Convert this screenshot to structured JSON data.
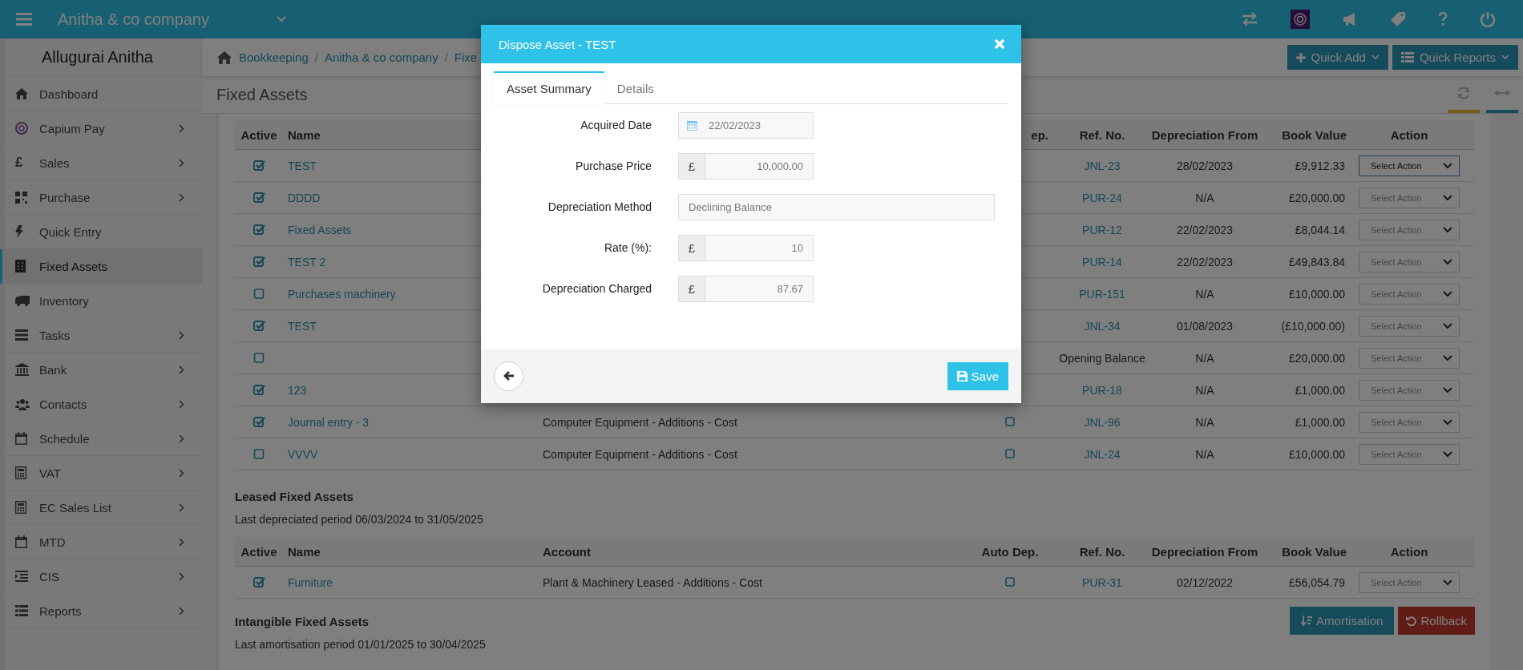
{
  "top_bar": {
    "company": "Anitha & co company"
  },
  "sidebar": {
    "user": "Allugurai Anitha",
    "items": [
      {
        "label": "Dashboard",
        "selected": false,
        "expandable": false
      },
      {
        "label": "Capium Pay",
        "selected": false,
        "expandable": true
      },
      {
        "label": "Sales",
        "selected": false,
        "expandable": true,
        "glyph": "£"
      },
      {
        "label": "Purchase",
        "selected": false,
        "expandable": true
      },
      {
        "label": "Quick Entry",
        "selected": false,
        "expandable": false
      },
      {
        "label": "Fixed Assets",
        "selected": true,
        "expandable": false
      },
      {
        "label": "Inventory",
        "selected": false,
        "expandable": false
      },
      {
        "label": "Tasks",
        "selected": false,
        "expandable": true
      },
      {
        "label": "Bank",
        "selected": false,
        "expandable": true
      },
      {
        "label": "Contacts",
        "selected": false,
        "expandable": true
      },
      {
        "label": "Schedule",
        "selected": false,
        "expandable": true
      },
      {
        "label": "VAT",
        "selected": false,
        "expandable": true
      },
      {
        "label": "EC Sales List",
        "selected": false,
        "expandable": true
      },
      {
        "label": "MTD",
        "selected": false,
        "expandable": true
      },
      {
        "label": "CIS",
        "selected": false,
        "expandable": true
      },
      {
        "label": "Reports",
        "selected": false,
        "expandable": true
      }
    ]
  },
  "breadcrumb": {
    "separator": "/",
    "items": [
      "Bookkeeping",
      "Anitha & co company",
      "Fixe"
    ]
  },
  "header_buttons": [
    "Quick Add",
    "Quick Reports"
  ],
  "page_title": "Fixed Assets",
  "fixed_assets": {
    "columns": {
      "active": "Active",
      "name": "Name",
      "column_4": "ep.",
      "ref": "Ref. No.",
      "dep_from": "Depreciation From",
      "book_value": "Book Value",
      "action": "Action"
    },
    "rows": [
      {
        "active": true,
        "name": "TEST",
        "ref": {
          "text": "JNL-23",
          "kind": "link"
        },
        "dep_from": "28/02/2023",
        "book_value": "£9,912.33",
        "action": "Select Action",
        "focused": true
      },
      {
        "active": true,
        "name": "DDDD",
        "ref": {
          "text": "PUR-24",
          "kind": "link"
        },
        "dep_from": "N/A",
        "book_value": "£20,000.00",
        "action": "Select Action",
        "focused": false
      },
      {
        "active": true,
        "name": "Fixed Assets",
        "ref": {
          "text": "PUR-12",
          "kind": "link"
        },
        "dep_from": "22/02/2023",
        "book_value": "£8,044.14",
        "action": "Select Action",
        "focused": false
      },
      {
        "active": true,
        "name": "TEST 2",
        "ref": {
          "text": "PUR-14",
          "kind": "link"
        },
        "dep_from": "22/02/2023",
        "book_value": "£49,843.84",
        "action": "Select Action",
        "focused": false
      },
      {
        "active": false,
        "name": "Purchases machinery",
        "ref": {
          "text": "PUR-151",
          "kind": "link"
        },
        "dep_from": "N/A",
        "book_value": "£10,000.00",
        "action": "Select Action",
        "focused": false
      },
      {
        "active": true,
        "name": "TEST",
        "ref": {
          "text": "JNL-34",
          "kind": "link"
        },
        "dep_from": "01/08/2023",
        "book_value": "(£10,000.00)",
        "action": "Select Action",
        "focused": false
      },
      {
        "active": false,
        "ref": {
          "text": "Opening Balance",
          "kind": "plain"
        },
        "dep_from": "N/A",
        "book_value": "£20,000.00",
        "action": "Select Action",
        "focused": false
      },
      {
        "active": true,
        "name": "123",
        "ref": {
          "text": "PUR-18",
          "kind": "link"
        },
        "dep_from": "N/A",
        "book_value": "£1,000.00",
        "action": "Select Action",
        "focused": false
      },
      {
        "active": true,
        "name": "Journal entry - 3",
        "account": "Computer Equipment - Additions - Cost",
        "auto_dep": false,
        "ref": {
          "text": "JNL-96",
          "kind": "link"
        },
        "dep_from": "N/A",
        "book_value": "£1,000.00",
        "action": "Select Action",
        "focused": false
      },
      {
        "active": false,
        "name": "VVVV",
        "account": "Computer Equipment - Additions - Cost",
        "auto_dep": false,
        "ref": {
          "text": "JNL-24",
          "kind": "link"
        },
        "dep_from": "N/A",
        "book_value": "£10,000.00",
        "action": "Select Action",
        "focused": false
      }
    ]
  },
  "leased": {
    "title": "Leased Fixed Assets",
    "period": "Last depreciated period 06/03/2024 to 31/05/2025",
    "columns": {
      "active": "Active",
      "name": "Name",
      "account": "Account",
      "auto_dep": "Auto Dep.",
      "ref": "Ref. No.",
      "dep_from": "Depreciation From",
      "book_value": "Book Value",
      "action": "Action"
    },
    "rows": [
      {
        "active": true,
        "name": "Furniture",
        "account": "Plant & Machinery Leased - Additions - Cost",
        "auto_dep": false,
        "ref": {
          "text": "PUR-31",
          "kind": "link"
        },
        "dep_from": "02/12/2022",
        "book_value": "£56,054.79",
        "action": "Select Action",
        "focused": false
      }
    ]
  },
  "intangible": {
    "title": "Intangible Fixed Assets",
    "period": "Last amortisation period 01/01/2025 to 30/04/2025",
    "buttons": [
      {
        "label": "Amortisation",
        "kind": "primary"
      },
      {
        "label": "Rollback",
        "kind": "danger"
      }
    ]
  },
  "modal": {
    "title": "Dispose Asset - TEST",
    "tabs": [
      {
        "label": "Asset Summary",
        "selected": true
      },
      {
        "label": "Details",
        "selected": false
      }
    ],
    "fields": [
      {
        "label": "Acquired Date",
        "kind": "date",
        "value": "22/02/2023"
      },
      {
        "label": "Purchase Price",
        "kind": "money",
        "prefix": "£",
        "value": "10,000.00"
      },
      {
        "label": "Depreciation Method",
        "kind": "text",
        "value": "Declining Balance"
      },
      {
        "label": "Rate (%):",
        "kind": "money",
        "prefix": "£",
        "value": "10"
      },
      {
        "label": "Depreciation Charged",
        "kind": "money",
        "prefix": "£",
        "value": "87.67"
      }
    ],
    "save": "Save"
  }
}
